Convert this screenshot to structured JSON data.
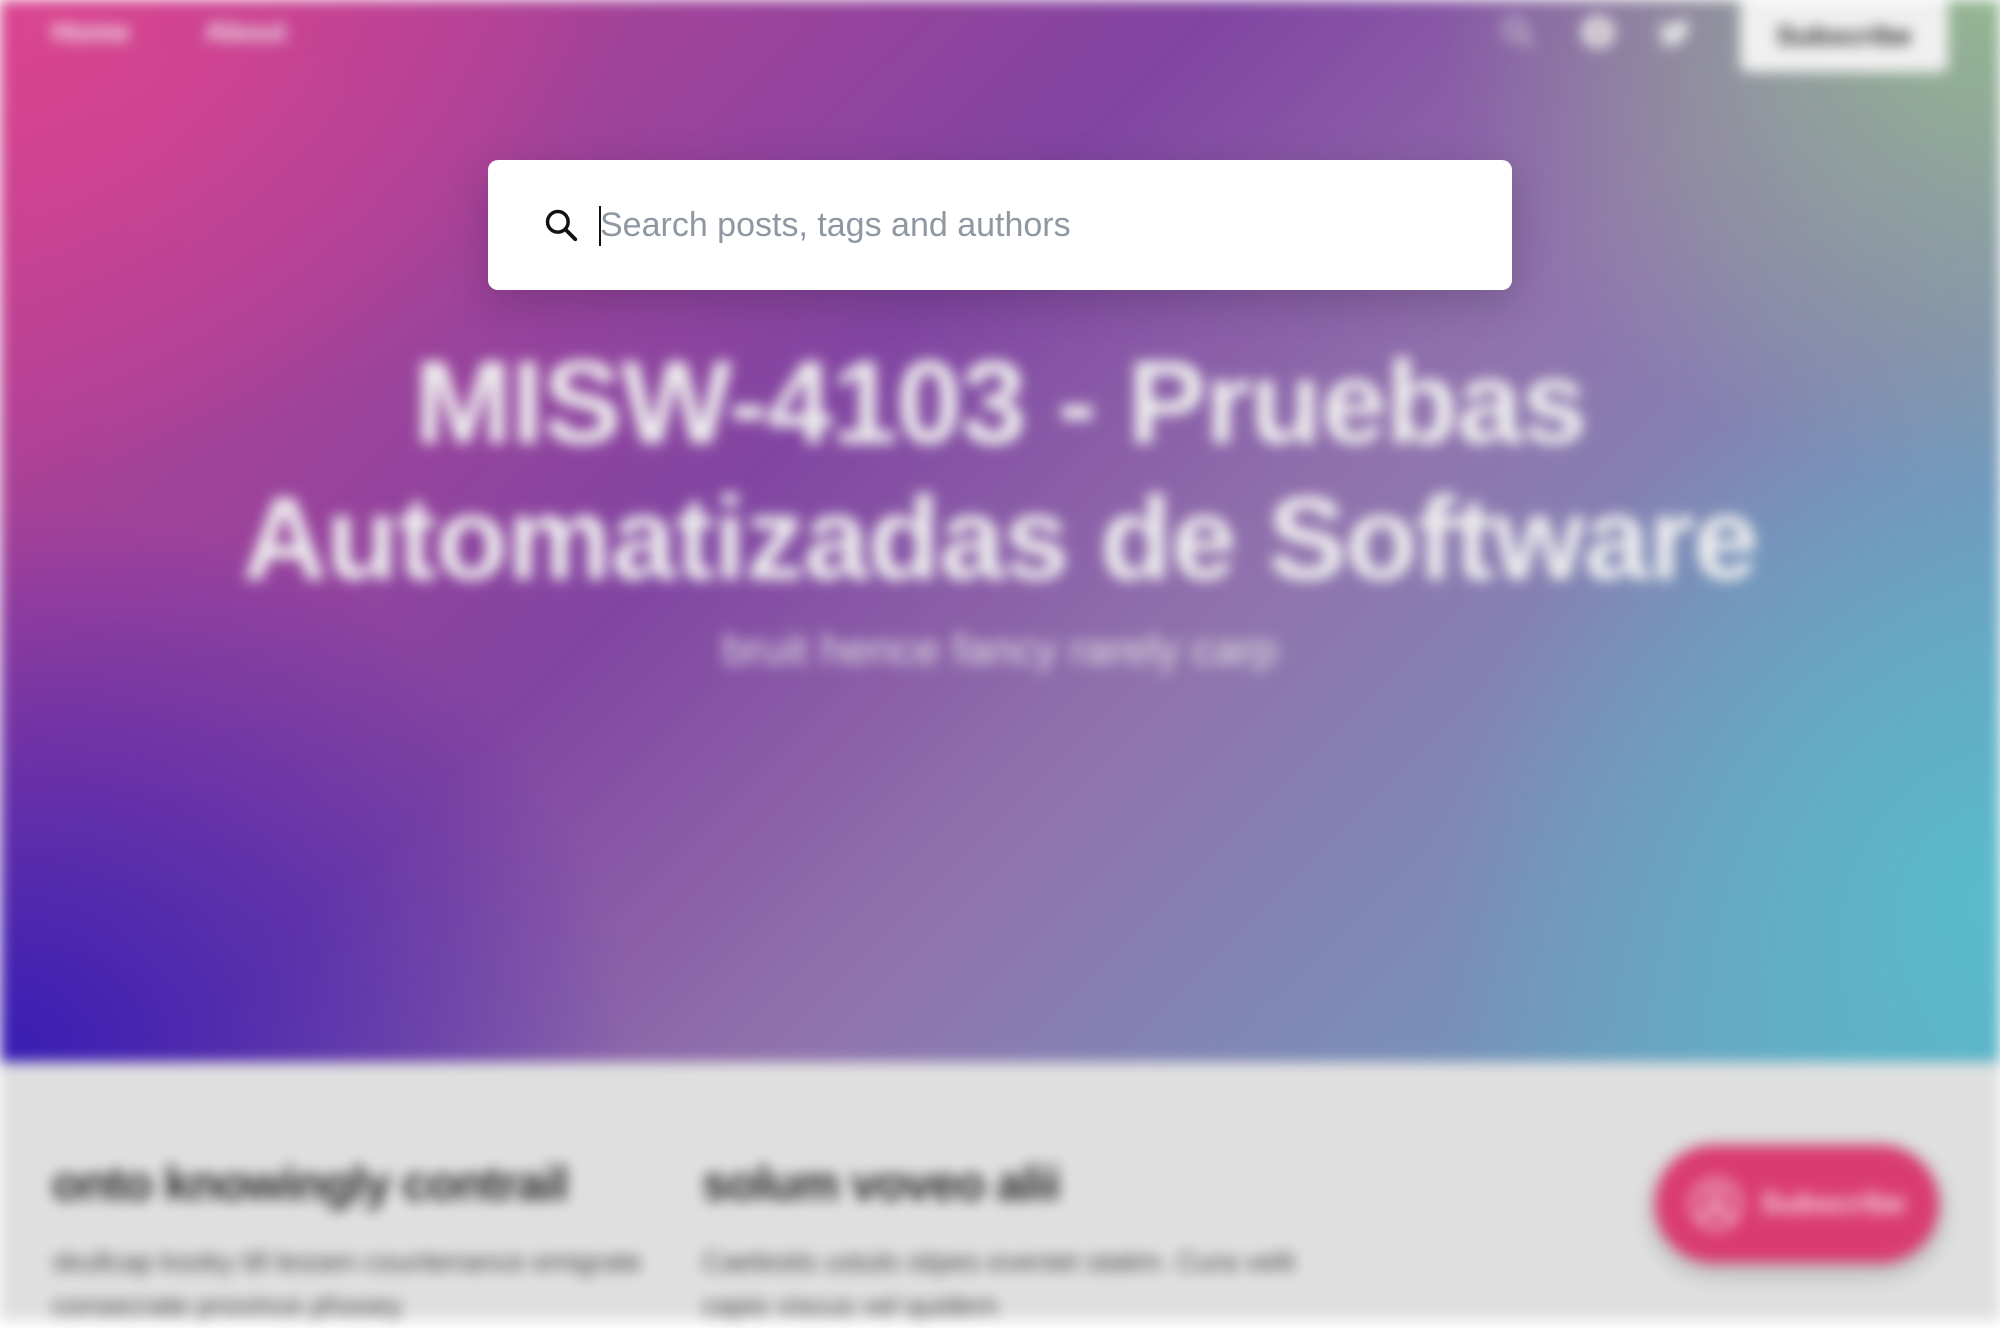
{
  "nav": {
    "links": [
      {
        "label": "Home"
      },
      {
        "label": "About"
      }
    ],
    "icons": [
      "search-icon",
      "facebook-icon",
      "twitter-icon"
    ],
    "subscribe_label": "Subscribe"
  },
  "hero": {
    "title": "MISW-4103 - Pruebas Automatizadas de Software",
    "subtitle": "bruit hence fancy rarely carp"
  },
  "posts": [
    {
      "title": "onto knowingly contrail",
      "excerpt": "skullcap kooky till lessen countenance emigrate consecrate province phooey"
    },
    {
      "title": "solum voveo alii",
      "excerpt": "Caelestis ustulo stipes eveniet statim. Cura velit capio viscus vel quidem"
    },
    {
      "title": "",
      "excerpt": ""
    }
  ],
  "floating_subscribe": {
    "label": "Subscribe",
    "icon": "user-circle-icon"
  },
  "search": {
    "placeholder": "Search posts, tags and authors",
    "value": "",
    "icon": "search-icon"
  },
  "colors": {
    "accent": "#d8306a",
    "hero_pink": "#c2338a",
    "hero_blue": "#2a0fb0",
    "hero_teal": "#4fb6c8",
    "placeholder": "#8f97a3"
  }
}
